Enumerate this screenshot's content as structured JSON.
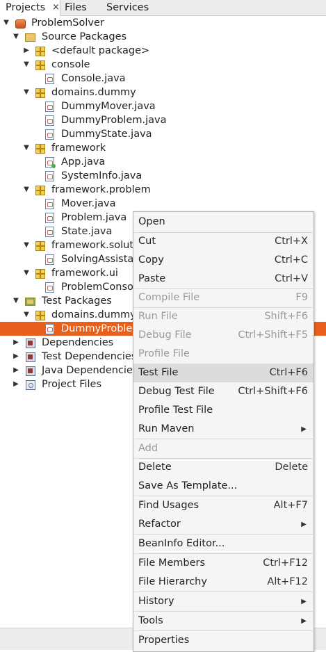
{
  "tabs": {
    "projects": "Projects",
    "close": "×",
    "files": "Files",
    "services": "Services"
  },
  "tree": {
    "root": "ProblemSolver",
    "source_packages": "Source Packages",
    "default_package": "<default package>",
    "console": "console",
    "console_java": "Console.java",
    "domains_dummy": "domains.dummy",
    "dummy_mover": "DummyMover.java",
    "dummy_problem": "DummyProblem.java",
    "dummy_state": "DummyState.java",
    "framework": "framework",
    "app_java": "App.java",
    "systeminfo_java": "SystemInfo.java",
    "framework_problem": "framework.problem",
    "mover_java": "Mover.java",
    "problem_java": "Problem.java",
    "state_java": "State.java",
    "framework_solution": "framework.solut",
    "solving_assistant": "SolvingAssistan",
    "framework_ui": "framework.ui",
    "problem_console": "ProblemConso",
    "test_packages": "Test Packages",
    "test_domains_dummy": "domains.dummy",
    "dummy_problem_test": "DummyProblem",
    "dependencies": "Dependencies",
    "test_dependencies": "Test Dependencies",
    "java_dependencies": "Java Dependencies",
    "project_files": "Project Files"
  },
  "menu": {
    "open": "Open",
    "cut": "Cut",
    "cut_sc": "Ctrl+X",
    "copy": "Copy",
    "copy_sc": "Ctrl+C",
    "paste": "Paste",
    "paste_sc": "Ctrl+V",
    "compile": "Compile File",
    "compile_sc": "F9",
    "run": "Run File",
    "run_sc": "Shift+F6",
    "debug": "Debug File",
    "debug_sc": "Ctrl+Shift+F5",
    "profile": "Profile File",
    "test": "Test File",
    "test_sc": "Ctrl+F6",
    "debug_test": "Debug Test File",
    "debug_test_sc": "Ctrl+Shift+F6",
    "profile_test": "Profile Test File",
    "run_maven": "Run Maven",
    "add": "Add",
    "delete": "Delete",
    "delete_sc": "Delete",
    "save_template": "Save As Template...",
    "find_usages": "Find Usages",
    "find_usages_sc": "Alt+F7",
    "refactor": "Refactor",
    "beaninfo": "BeanInfo Editor...",
    "file_members": "File Members",
    "file_members_sc": "Ctrl+F12",
    "file_hierarchy": "File Hierarchy",
    "file_hierarchy_sc": "Alt+F12",
    "history": "History",
    "tools": "Tools",
    "properties": "Properties"
  },
  "colors": {
    "selection": "#e8601c",
    "menu_highlight": "#dcdcdc"
  }
}
